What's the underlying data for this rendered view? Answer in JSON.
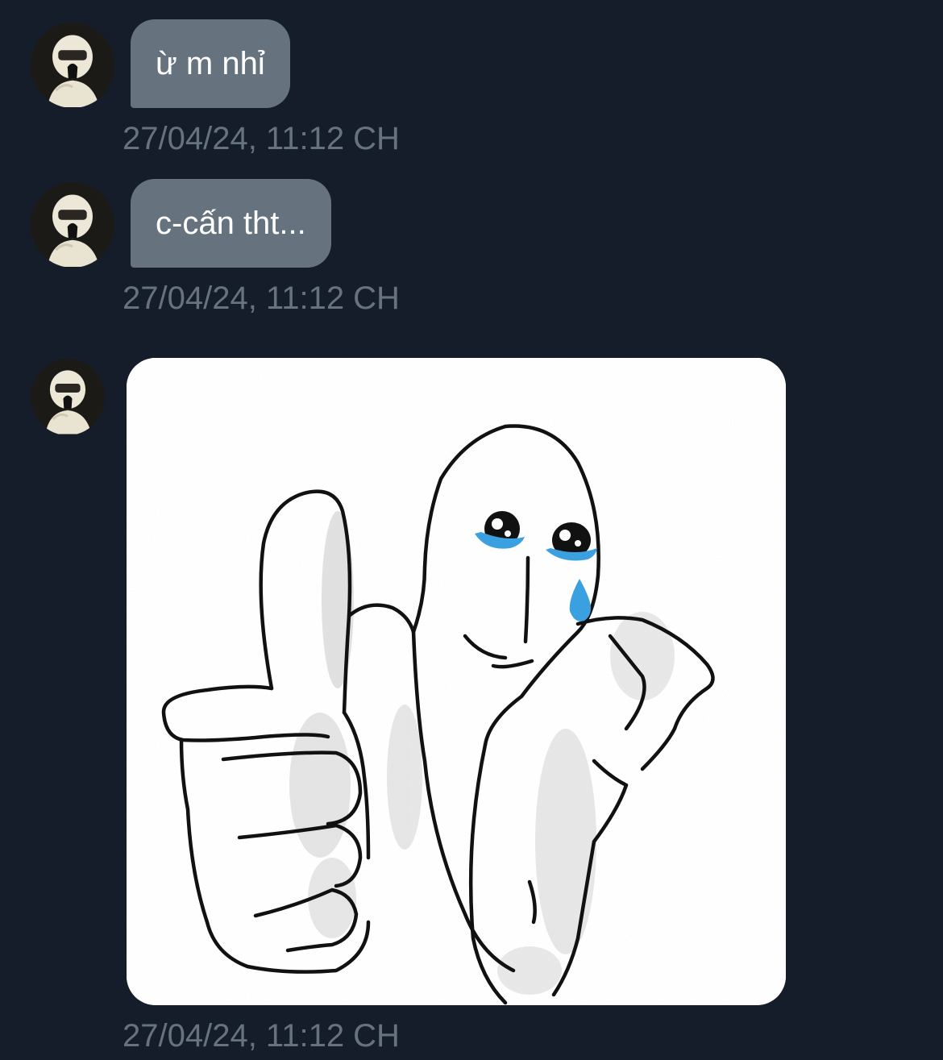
{
  "messages": [
    {
      "type": "text",
      "text": "ừ m nhỉ",
      "timestamp": "27/04/24, 11:12 CH"
    },
    {
      "type": "text",
      "text": "c-cấn tht...",
      "timestamp": "27/04/24, 11:12 CH"
    },
    {
      "type": "sticker",
      "sticker": "thumbs-up-crying-meme",
      "timestamp": "27/04/24, 11:12 CH"
    }
  ],
  "colors": {
    "background": "#151d2a",
    "bubble": "#66737f",
    "timestamp": "#66737f",
    "bubble_text": "#ffffff",
    "tear": "#3aa0e0"
  }
}
